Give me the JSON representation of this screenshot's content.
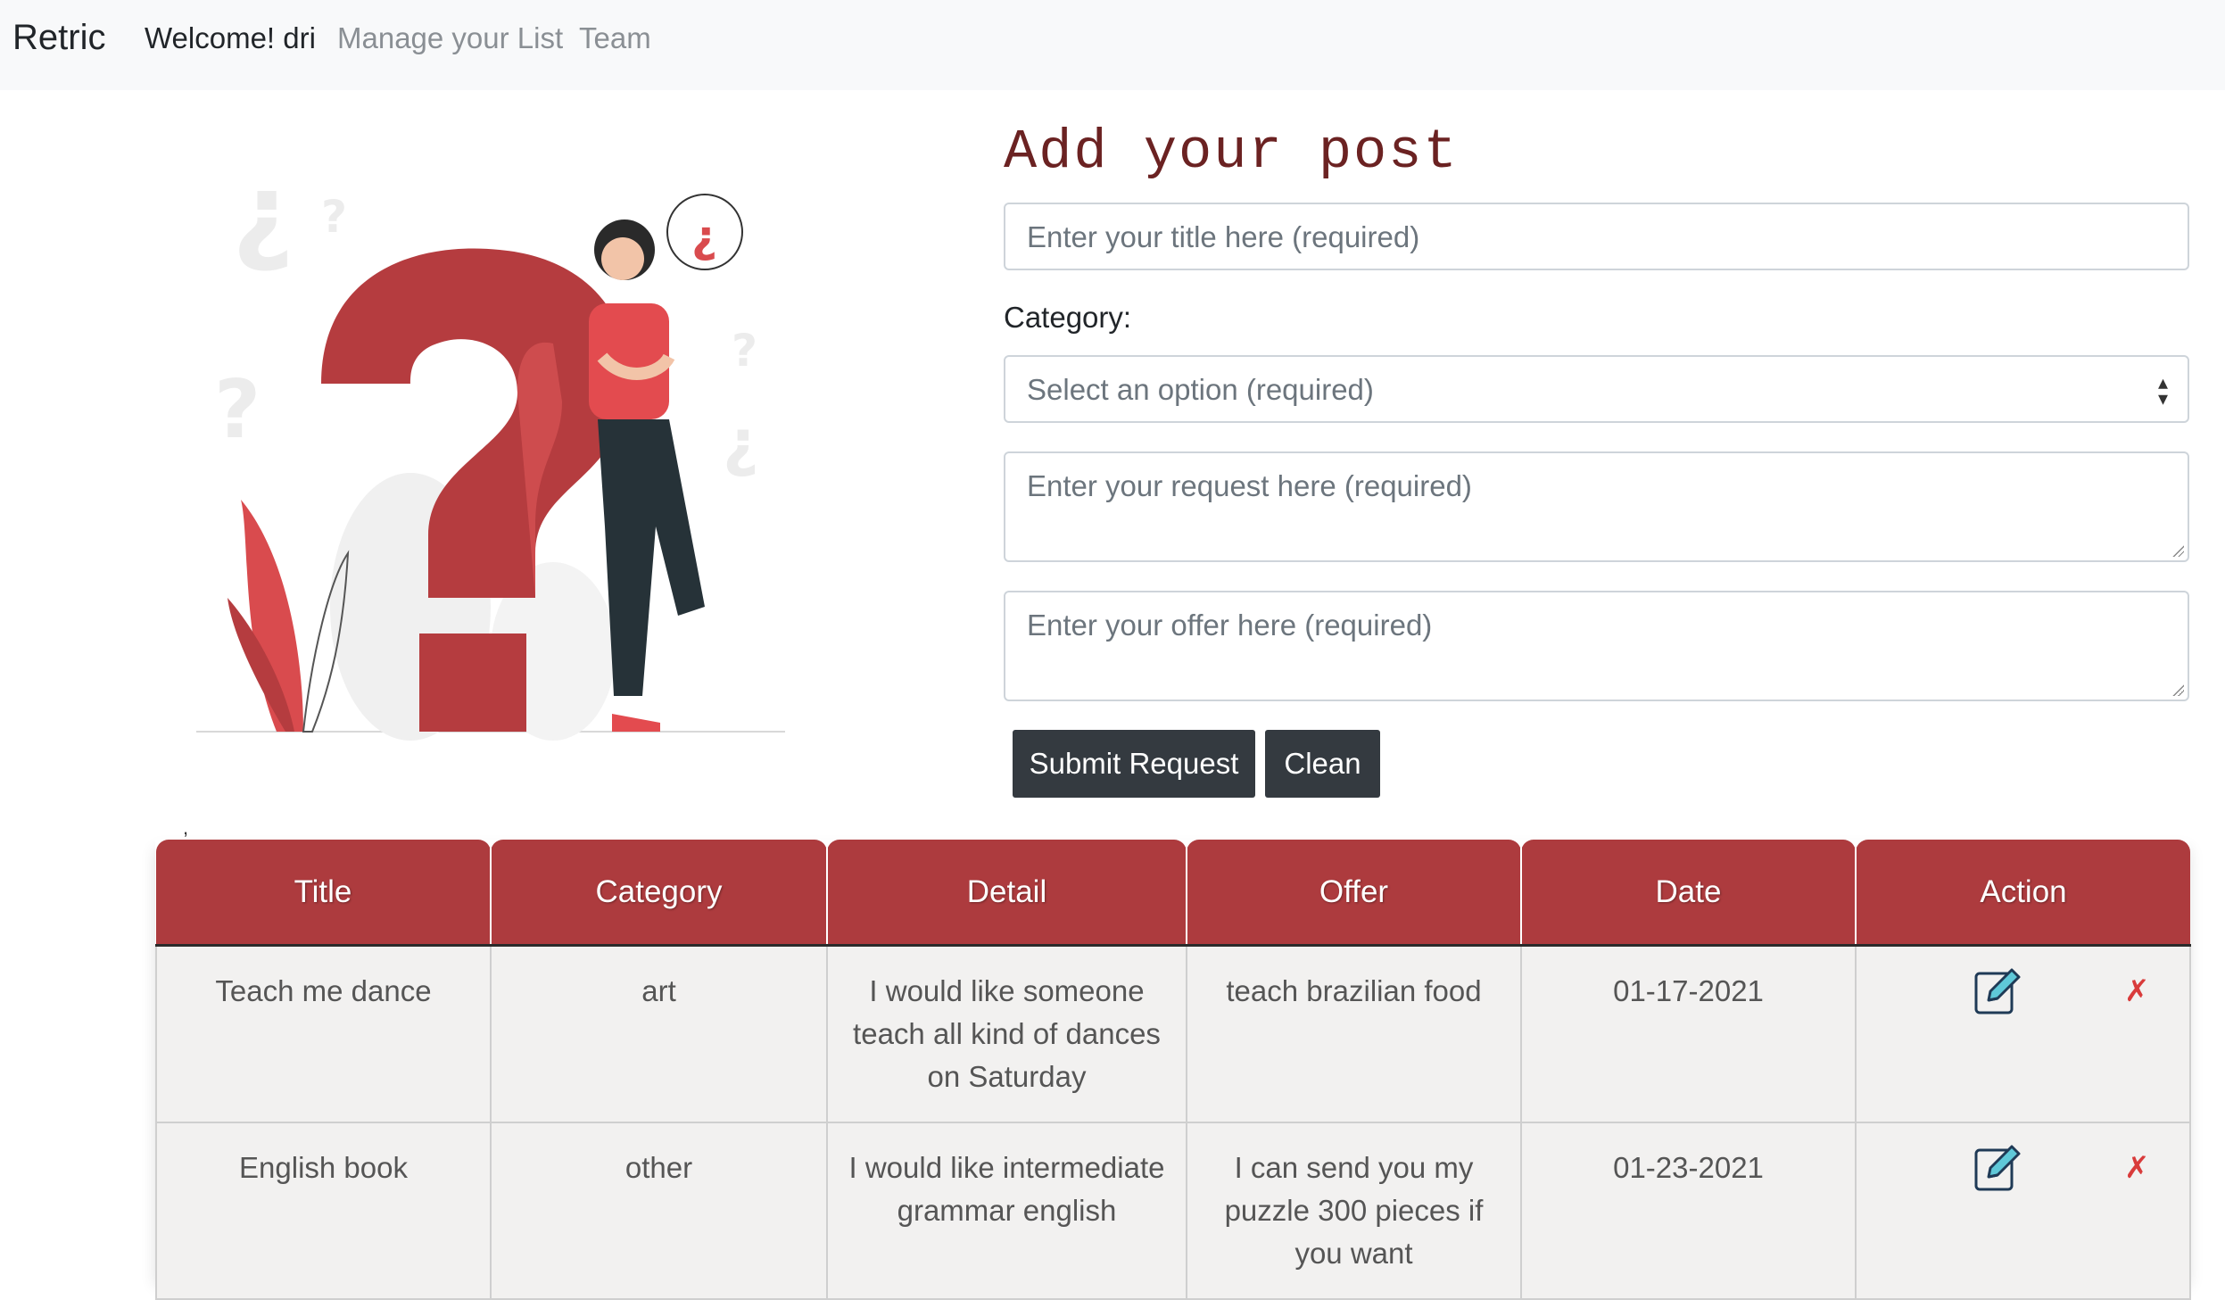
{
  "nav": {
    "brand": "Retric",
    "welcome": "Welcome! dri",
    "links": [
      "Manage your List",
      "Team"
    ]
  },
  "form": {
    "heading": "Add your post",
    "title_placeholder": "Enter your title here (required)",
    "category_label": "Category:",
    "category_selected": "Select an option (required)",
    "request_placeholder": "Enter your request here (required)",
    "offer_placeholder": "Enter your offer here (required)",
    "submit_label": "Submit Request",
    "clean_label": "Clean"
  },
  "stray_mark": ",",
  "table": {
    "headers": [
      "Title",
      "Category",
      "Detail",
      "Offer",
      "Date",
      "Action"
    ],
    "rows": [
      {
        "title": "Teach me dance",
        "category": "art",
        "detail": "I would like someone teach all kind of dances on Saturday",
        "offer": "teach brazilian food",
        "date": "01-17-2021",
        "delete": "✗"
      },
      {
        "title": "English book",
        "category": "other",
        "detail": "I would like intermediate grammar english",
        "offer": "I can send you my puzzle 300 pieces if you want",
        "date": "01-23-2021",
        "delete": "✗"
      }
    ]
  },
  "colors": {
    "accent_red": "#ad3b3e",
    "illustration_red": "#b53c3f",
    "dark_button": "#343a40",
    "heading_color": "#6b2222"
  },
  "icons": [
    "question-person-illustration",
    "edit-icon",
    "delete-icon",
    "select-arrows-icon"
  ]
}
